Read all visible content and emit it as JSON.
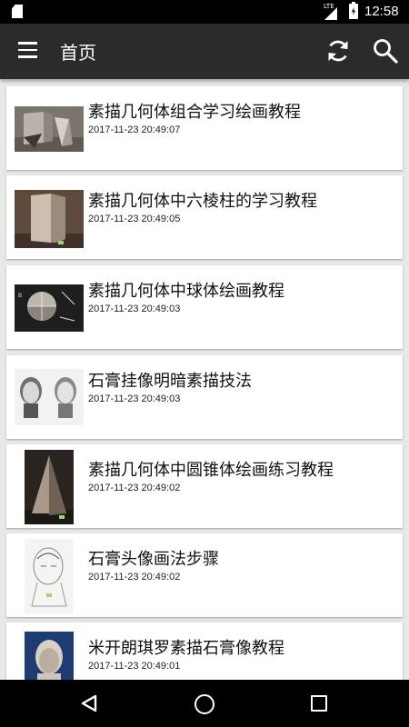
{
  "status_bar": {
    "network": "LTE",
    "time": "12:58"
  },
  "app_bar": {
    "title": "首页"
  },
  "items": [
    {
      "title": "素描几何体组合学习绘画教程",
      "time": "2017-11-23 20:49:07"
    },
    {
      "title": "素描几何体中六棱柱的学习教程",
      "time": "2017-11-23 20:49:05"
    },
    {
      "title": "素描几何体中球体绘画教程",
      "time": "2017-11-23 20:49:03"
    },
    {
      "title": "石膏挂像明暗素描技法",
      "time": "2017-11-23 20:49:03"
    },
    {
      "title": "素描几何体中圆锥体绘画练习教程",
      "time": "2017-11-23 20:49:02"
    },
    {
      "title": "石膏头像画法步骤",
      "time": "2017-11-23 20:49:02"
    },
    {
      "title": "米开朗琪罗素描石膏像教程",
      "time": "2017-11-23 20:49:01"
    }
  ],
  "colors": {
    "app_bar": "#2b2b2b",
    "status_bar": "#000000",
    "nav_bar": "#000000",
    "background": "#e8e8e8",
    "card": "#ffffff"
  }
}
